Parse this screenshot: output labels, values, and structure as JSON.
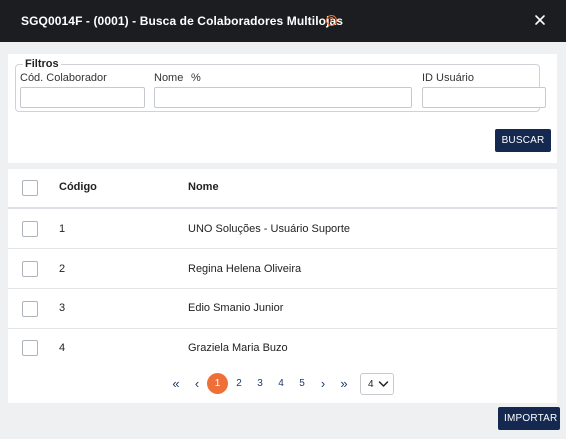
{
  "dialog": {
    "title": "SGQ0014F - (0001) - Busca de Colaboradores Multilojas",
    "help_symbol": "?"
  },
  "filters": {
    "legend": "Filtros",
    "cod_label": "Cód. Colaborador",
    "cod_value": "",
    "nome_label": "Nome",
    "nome_wildcard": "%",
    "nome_value": "",
    "id_label": "ID Usuário",
    "id_value": "",
    "search_button": "BUSCAR"
  },
  "table": {
    "headers": {
      "codigo": "Código",
      "nome": "Nome"
    },
    "rows": [
      {
        "codigo": "1",
        "nome": "UNO Soluções - Usuário Suporte"
      },
      {
        "codigo": "2",
        "nome": "Regina Helena Oliveira"
      },
      {
        "codigo": "3",
        "nome": "Edio Smanio Junior"
      },
      {
        "codigo": "4",
        "nome": "Graziela Maria Buzo"
      }
    ]
  },
  "pagination": {
    "first": "«",
    "prev": "‹",
    "pages": [
      "1",
      "2",
      "3",
      "4",
      "5"
    ],
    "current_page": "1",
    "next": "›",
    "last": "»",
    "page_size": "4"
  },
  "footer": {
    "import_button": "IMPORTAR"
  },
  "colors": {
    "title_bar": "#1c1d20",
    "primary_button": "#142850",
    "accent": "#ee7038"
  }
}
